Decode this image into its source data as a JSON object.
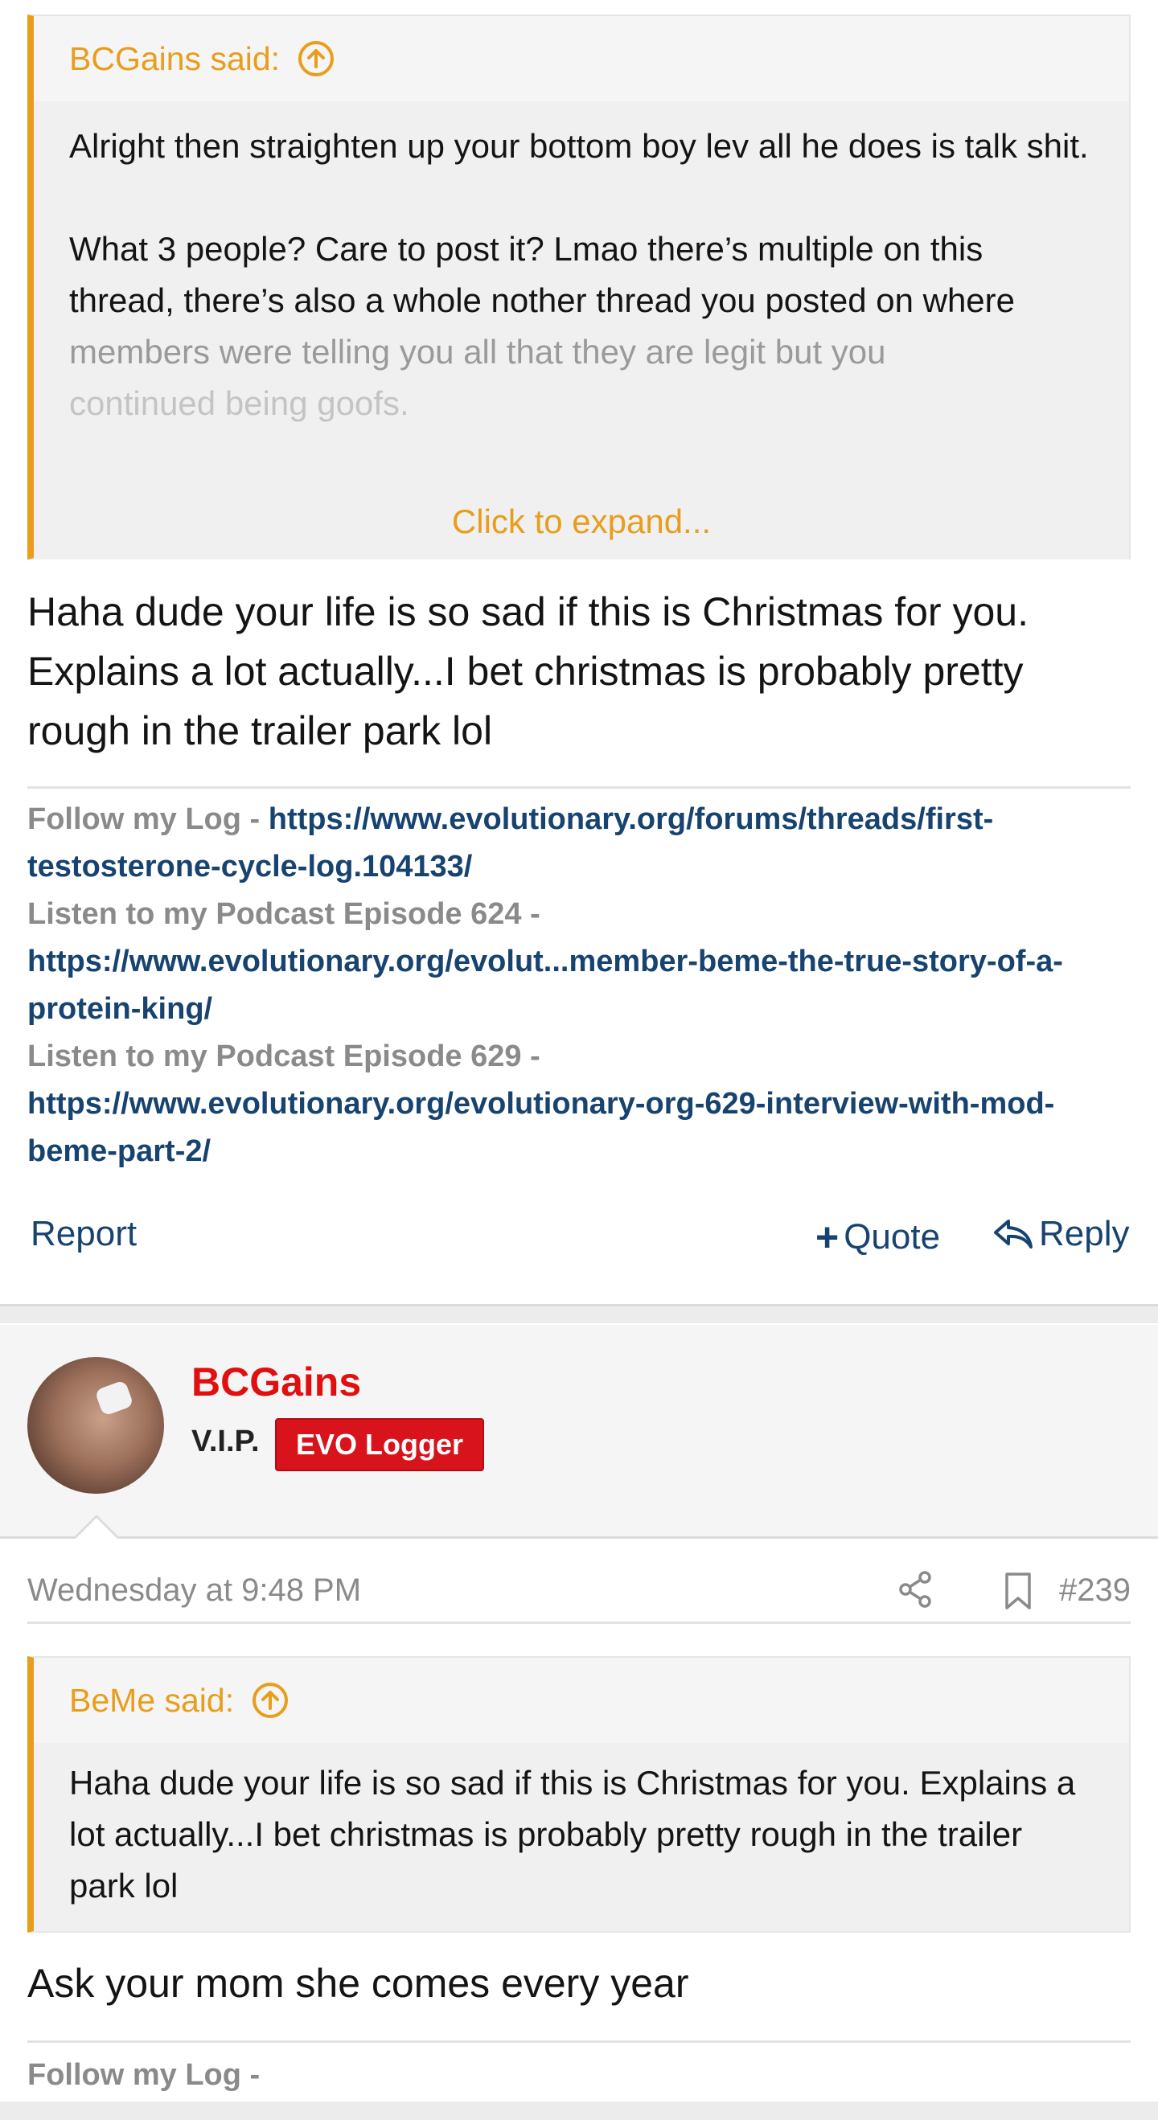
{
  "post1": {
    "quote": {
      "author_line": "BCGains said:",
      "paragraphs": [
        "Alright then straighten up your bottom boy lev all he does is talk shit.",
        "What 3 people? Care to post it? Lmao there’s multiple on this thread, there’s also a whole nother thread you posted on where",
        "members were telling you all that they are legit but you",
        "continued being goofs."
      ],
      "expand_label": "Click to expand..."
    },
    "message": "Haha dude your life is so sad if this is Christmas for you. Explains a lot actually...I bet christmas is probably pretty rough in the trailer park lol",
    "signature": {
      "log_label": "Follow my Log - ",
      "log_link": "https://www.evolutionary.org/forums/threads/first-testosterone-cycle-log.104133/",
      "pod1_label": "Listen to my Podcast Episode 624 - ",
      "pod1_link": "https://www.evolutionary.org/evolut...member-beme-the-true-story-of-a-protein-king/",
      "pod2_label": "Listen to my Podcast Episode 629 - ",
      "pod2_link": "https://www.evolutionary.org/evolutionary-org-629-interview-with-mod-beme-part-2/"
    },
    "actions": {
      "report": "Report",
      "quote": "Quote",
      "reply": "Reply"
    }
  },
  "post2": {
    "user": {
      "name": "BCGains",
      "title": "V.I.P.",
      "badge": "EVO Logger"
    },
    "date": "Wednesday at 9:48 PM",
    "post_number": "#239",
    "quote": {
      "author_line": "BeMe said:",
      "text": "Haha dude your life is so sad if this is Christmas for you. Explains a lot actually...I bet christmas is probably pretty rough in the trailer park lol"
    },
    "message": "Ask your mom she comes every year",
    "signature": {
      "log_label": "Follow my Log -"
    }
  },
  "colors": {
    "accent_orange": "#e89d1c",
    "link_blue": "#174370",
    "username_red": "#e01010",
    "badge_red": "#d8131b"
  }
}
